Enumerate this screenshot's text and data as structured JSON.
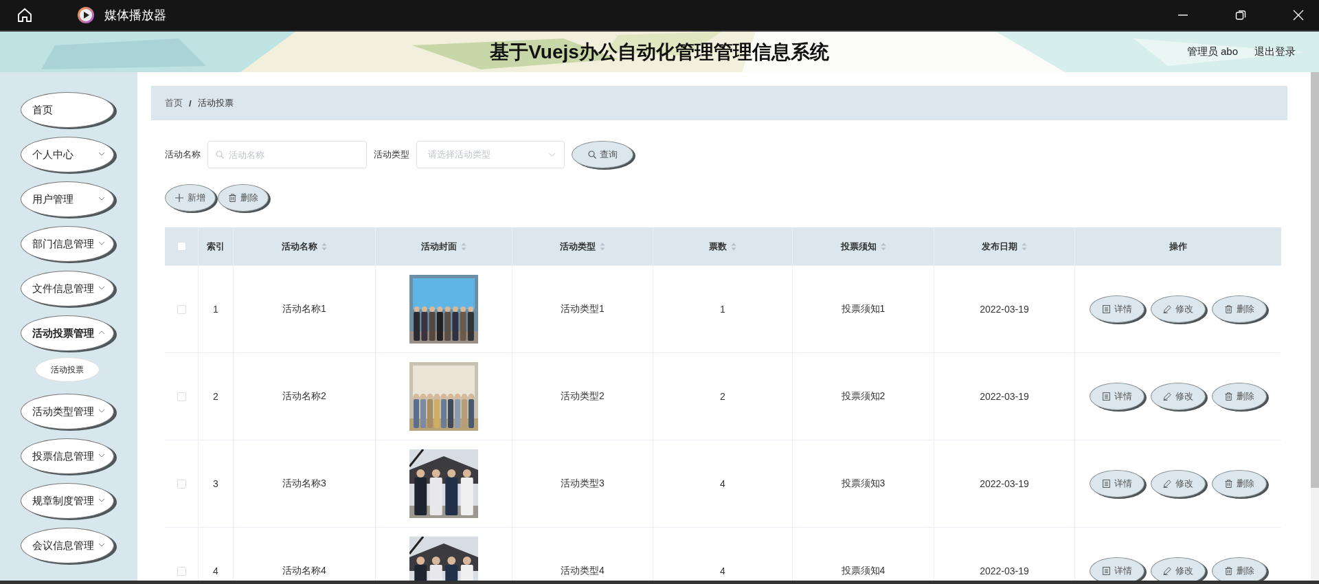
{
  "app_window": {
    "title": "媒体播放器"
  },
  "header": {
    "title": "基于Vuejs办公自动化管理管理信息系统",
    "user": "管理员 abo",
    "logout": "退出登录"
  },
  "sidebar": {
    "items": [
      {
        "label": "首页",
        "has_submenu": false,
        "expanded": false
      },
      {
        "label": "个人中心",
        "has_submenu": true,
        "expanded": false
      },
      {
        "label": "用户管理",
        "has_submenu": true,
        "expanded": false
      },
      {
        "label": "部门信息管理",
        "has_submenu": true,
        "expanded": false
      },
      {
        "label": "文件信息管理",
        "has_submenu": true,
        "expanded": false
      },
      {
        "label": "活动投票管理",
        "has_submenu": true,
        "expanded": true,
        "children": [
          {
            "label": "活动投票"
          }
        ]
      },
      {
        "label": "活动类型管理",
        "has_submenu": true,
        "expanded": false
      },
      {
        "label": "投票信息管理",
        "has_submenu": true,
        "expanded": false
      },
      {
        "label": "规章制度管理",
        "has_submenu": true,
        "expanded": false
      },
      {
        "label": "会议信息管理",
        "has_submenu": true,
        "expanded": false
      }
    ]
  },
  "breadcrumb": {
    "separator": "/",
    "items": [
      {
        "label": "首页"
      },
      {
        "label": "活动投票"
      }
    ]
  },
  "search": {
    "fields": [
      {
        "kind": "text",
        "label": "活动名称",
        "placeholder": "活动名称"
      },
      {
        "kind": "select",
        "label": "活动类型",
        "placeholder": "请选择活动类型"
      }
    ],
    "button": "查询"
  },
  "toolbar": [
    {
      "kind": "add",
      "label": "新增"
    },
    {
      "kind": "delete",
      "label": "删除"
    }
  ],
  "table": {
    "all_selected": false,
    "columns": [
      {
        "label": "索引",
        "sortable": false
      },
      {
        "label": "活动名称",
        "sortable": true
      },
      {
        "label": "活动封面",
        "sortable": true
      },
      {
        "label": "活动类型",
        "sortable": true
      },
      {
        "label": "票数",
        "sortable": true
      },
      {
        "label": "投票须知",
        "sortable": true
      },
      {
        "label": "发布日期",
        "sortable": true
      },
      {
        "label": "操作",
        "sortable": false
      }
    ],
    "rows": [
      {
        "selected": false,
        "index": "1",
        "name": "活动名称1",
        "cover": {
          "kind": "picture"
        },
        "type": "活动类型1",
        "votes": "1",
        "notice": "投票须知1",
        "date": "2022-03-19",
        "actions": [
          {
            "kind": "detail",
            "label": "详情"
          },
          {
            "kind": "edit",
            "label": "修改"
          },
          {
            "kind": "delete",
            "label": "删除"
          }
        ]
      },
      {
        "selected": false,
        "index": "2",
        "name": "活动名称2",
        "cover": {
          "kind": "picture"
        },
        "type": "活动类型2",
        "votes": "2",
        "notice": "投票须知2",
        "date": "2022-03-19",
        "actions": [
          {
            "kind": "detail",
            "label": "详情"
          },
          {
            "kind": "edit",
            "label": "修改"
          },
          {
            "kind": "delete",
            "label": "删除"
          }
        ]
      },
      {
        "selected": false,
        "index": "3",
        "name": "活动名称3",
        "cover": {
          "kind": "picture"
        },
        "type": "活动类型3",
        "votes": "4",
        "notice": "投票须知3",
        "date": "2022-03-19",
        "actions": [
          {
            "kind": "detail",
            "label": "详情"
          },
          {
            "kind": "edit",
            "label": "修改"
          },
          {
            "kind": "delete",
            "label": "删除"
          }
        ]
      },
      {
        "selected": false,
        "index": "4",
        "name": "活动名称4",
        "cover": {
          "kind": "picture"
        },
        "type": "活动类型4",
        "votes": "4",
        "notice": "投票须知4",
        "date": "2022-03-19",
        "actions": [
          {
            "kind": "detail",
            "label": "详情"
          },
          {
            "kind": "edit",
            "label": "修改"
          },
          {
            "kind": "delete",
            "label": "删除"
          }
        ]
      }
    ]
  }
}
